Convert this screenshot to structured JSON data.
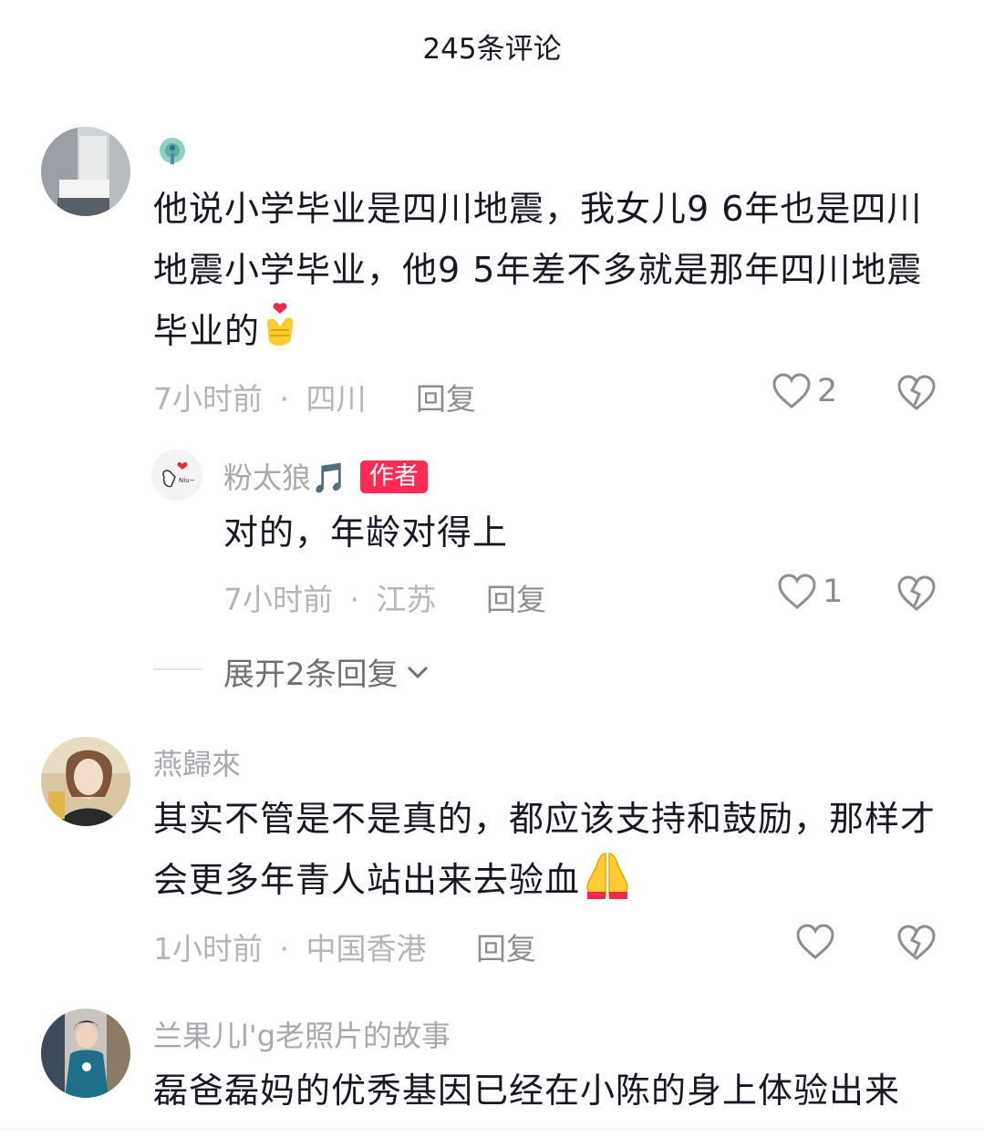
{
  "header": {
    "title": "245条评论"
  },
  "comments": [
    {
      "username": "",
      "text": "他说小学毕业是四川地震，我女儿9 6年也是四川地震小学毕业，他9 5年差不多就是那年四川地震毕业的",
      "emoji": "finger-heart-emoji",
      "time": "7小时前",
      "location": "四川",
      "reply_label": "回复",
      "likes": "2"
    },
    {
      "username": "粉太狼🎵",
      "badge": "作者",
      "text": "对的，年龄对得上",
      "time": "7小时前",
      "location": "江苏",
      "reply_label": "回复",
      "likes": "1"
    },
    {
      "username": "燕歸來",
      "text": "其实不管是不是真的，都应该支持和鼓励，那样才会更多年青人站出来去验血",
      "emoji": "folded-hands-emoji",
      "time": "1小时前",
      "location": "中国香港",
      "reply_label": "回复",
      "likes": ""
    },
    {
      "username": "兰果儿l'g老照片的故事",
      "text": "磊爸磊妈的优秀基因已经在小陈的身上体验出来"
    }
  ],
  "expand_replies": {
    "label": "展开2条回复"
  },
  "separator": "·",
  "colors": {
    "accent": "#fe2c55",
    "muted": "#b4b5b9",
    "text": "#161823"
  }
}
